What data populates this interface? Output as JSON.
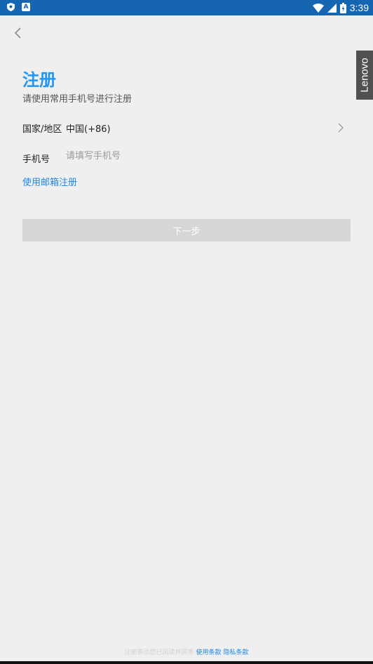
{
  "status_bar": {
    "time": "3:39",
    "left_icons": [
      "shield-icon",
      "a-box-icon"
    ],
    "right_icons": [
      "wifi-icon",
      "signal-icon",
      "battery-icon"
    ]
  },
  "header": {
    "back_icon": "chevron-left-icon"
  },
  "brand": {
    "tab_label": "Lenovo"
  },
  "page": {
    "title": "注册",
    "subtitle": "请使用常用手机号进行注册"
  },
  "form": {
    "country": {
      "label": "国家/地区",
      "value": "中国(+86)"
    },
    "phone": {
      "label": "手机号",
      "placeholder": "请填写手机号",
      "value": ""
    },
    "email_link": "使用邮箱注册",
    "next_button": "下一步"
  },
  "footer": {
    "notice": "注册表示您已阅读并同意",
    "terms_link": "使用条款",
    "privacy_link": "隐私条款"
  },
  "colors": {
    "status_bar": "#1565b0",
    "accent": "#2196f3",
    "link": "#1e88e5",
    "background": "#efefef",
    "button_disabled": "#d6d6d6",
    "brand_tab": "#505050"
  }
}
